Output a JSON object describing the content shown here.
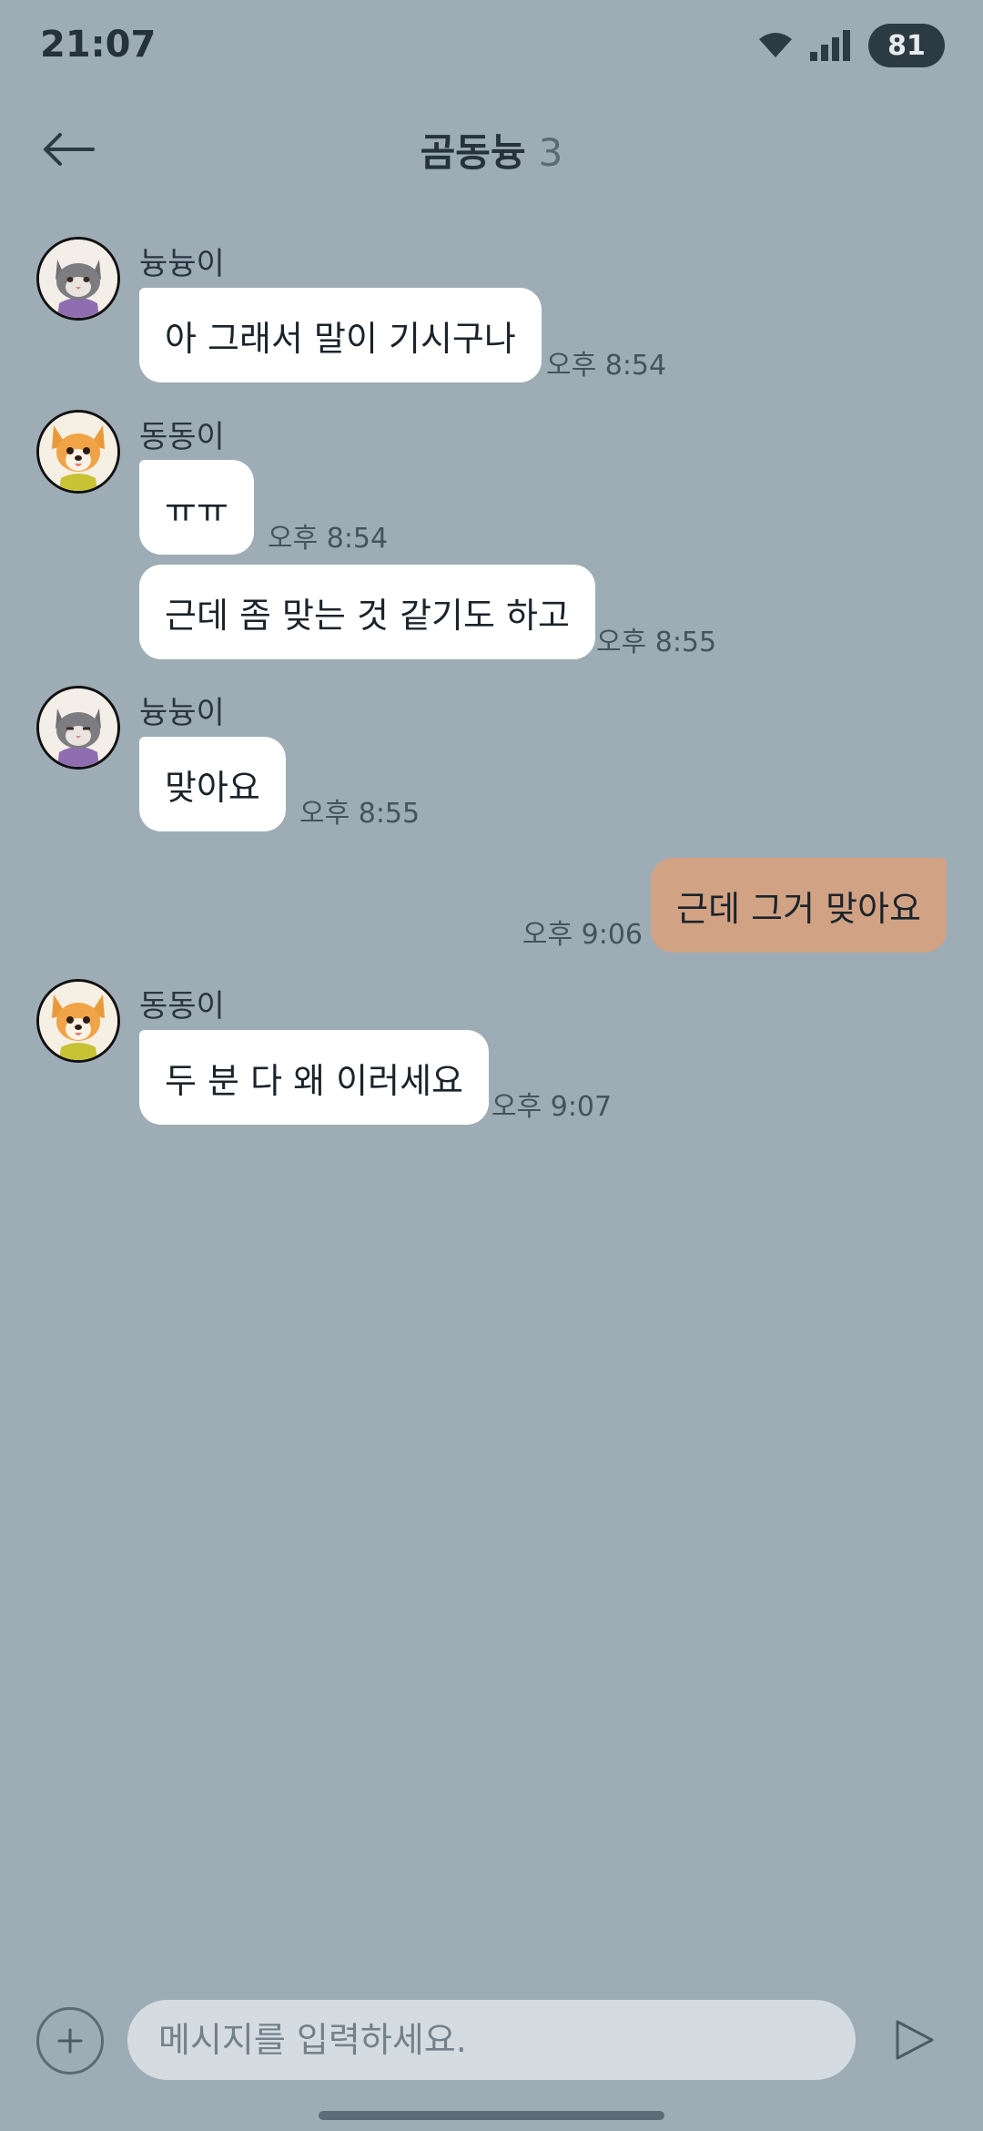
{
  "status_bar": {
    "time": "21:07",
    "battery": "81",
    "icons": [
      "wifi-icon",
      "signal-icon"
    ]
  },
  "header": {
    "title": "곰동늉",
    "member_count": "3",
    "back_icon": "back-arrow-icon"
  },
  "messages": [
    {
      "sender": "늉늉이",
      "avatar": "cat-avatar",
      "text": "아 그래서 말이 기시구나",
      "time": "오후 8:54"
    },
    {
      "sender": "동동이",
      "avatar": "dog-avatar",
      "text": "ㅠㅠ",
      "time": "오후 8:54"
    },
    {
      "sender": "",
      "text": "근데 좀 맞는 것 같기도 하고",
      "time": "오후 8:55"
    },
    {
      "sender": "늉늉이",
      "avatar": "cat-avatar",
      "text": "맞아요",
      "time": "오후 8:55"
    },
    {
      "sender": "me",
      "text": "근데 그거 맞아요",
      "time": "오후 9:06"
    },
    {
      "sender": "동동이",
      "avatar": "dog-avatar",
      "text": "두 분 다 왜 이러세요",
      "time": "오후 9:07"
    }
  ],
  "input": {
    "placeholder": "메시지를 입력하세요.",
    "value": ""
  },
  "colors": {
    "background": "#9eacb6",
    "my_bubble": "#d1a284",
    "other_bubble": "#ffffff"
  }
}
